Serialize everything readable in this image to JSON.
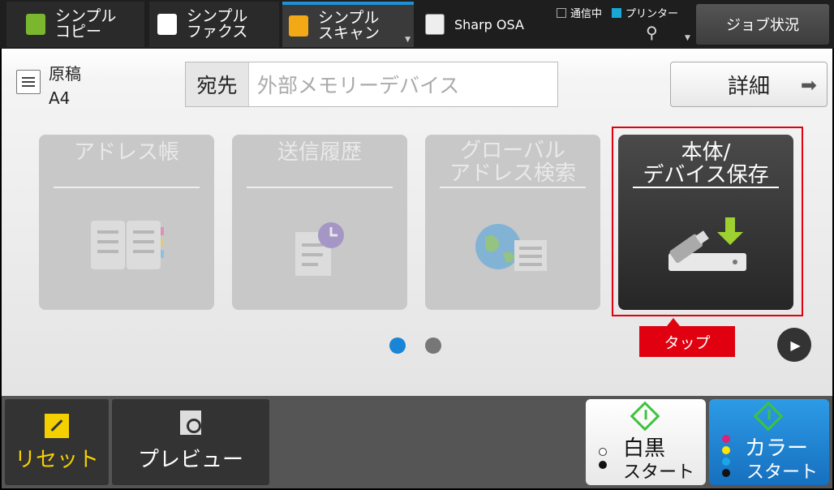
{
  "tabs": [
    {
      "label": "シンプル\nコピー",
      "icon": "copy-icon"
    },
    {
      "label": "シンプル\nファクス",
      "icon": "fax-icon"
    },
    {
      "label": "シンプル\nスキャン",
      "icon": "scan-icon",
      "active": true
    },
    {
      "label": "Sharp OSA",
      "icon": "osa-icon"
    }
  ],
  "status": {
    "communicating": "通信中",
    "printer": "プリンター"
  },
  "job_status_label": "ジョブ状況",
  "original": {
    "label": "原稿",
    "size": "A4"
  },
  "destination": {
    "label": "宛先",
    "value": "外部メモリーデバイス"
  },
  "detail_label": "詳細",
  "tiles": [
    {
      "label": "アドレス帳",
      "enabled": false
    },
    {
      "label": "送信履歴",
      "enabled": false
    },
    {
      "label": "グローバル\nアドレス検索",
      "enabled": false
    },
    {
      "label": "本体/\nデバイス保存",
      "enabled": true
    }
  ],
  "tap_callout": "タップ",
  "pager": {
    "current": 1,
    "total": 2
  },
  "bottom": {
    "reset_label": "リセット",
    "preview_label": "プレビュー",
    "bw_start": {
      "main": "白黒",
      "sub": "スタート"
    },
    "color_start": {
      "main": "カラー",
      "sub": "スタート"
    }
  },
  "colors": {
    "accent_blue": "#1a85d6",
    "highlight_red": "#e0000f",
    "reset_yellow": "#f5d000"
  }
}
